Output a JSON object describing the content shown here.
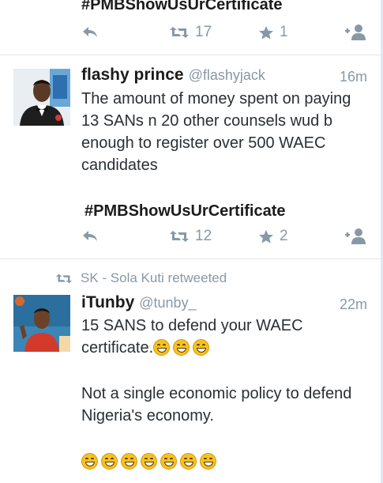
{
  "tweet1": {
    "hashtag": "#PMBShowUsUrCertificate",
    "retweet_count": "17",
    "favorite_count": "1"
  },
  "tweet2": {
    "name": "flashy prince",
    "handle": "@flashyjack",
    "time": "16m",
    "text": "The amount of money spent on paying 13 SANs n 20 other counsels wud b enough to register over 500 WAEC candidates",
    "hashtag": "#PMBShowUsUrCertificate",
    "retweet_count": "12",
    "favorite_count": "2"
  },
  "tweet3": {
    "retweeted_by": "SK - Sola Kuti retweeted",
    "name": "iTunby",
    "handle": "@tunby_",
    "time": "22m",
    "text_line1": "15 SANS to defend your WAEC certificate.",
    "text_para2": "Not a single economic policy to defend Nigeria's economy.",
    "emoji_name": "grinning-face-emoji"
  },
  "icons": {
    "reply": "reply-icon",
    "retweet": "retweet-icon",
    "favorite": "star-icon",
    "follow": "follow-icon"
  },
  "colors": {
    "icon_gray": "#8899a6",
    "divider": "#e1e8ed",
    "text": "#292f33"
  }
}
